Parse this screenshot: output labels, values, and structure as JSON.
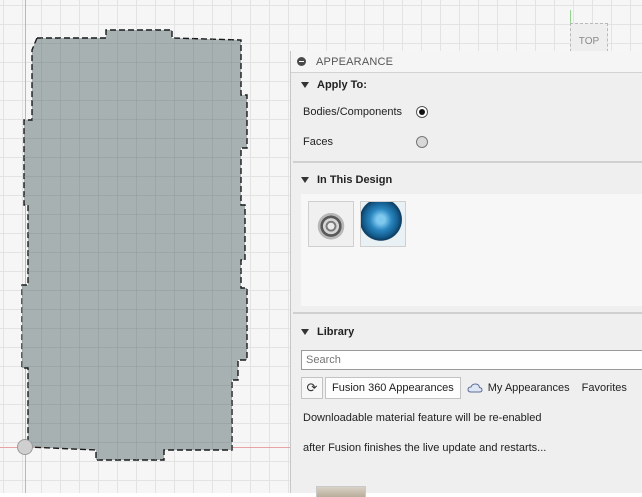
{
  "viewcube": {
    "face_label": "TOP"
  },
  "panel": {
    "title": "APPEARANCE",
    "apply_to": {
      "heading": "Apply To:",
      "options": [
        {
          "label": "Bodies/Components",
          "selected": true
        },
        {
          "label": "Faces",
          "selected": false
        }
      ]
    },
    "in_this_design": {
      "heading": "In This Design",
      "thumbnails": [
        "metal-material-thumbnail",
        "glass-material-thumbnail"
      ]
    },
    "library": {
      "heading": "Library",
      "search_placeholder": "Search",
      "tabs": {
        "fusion": "Fusion 360 Appearances",
        "mine": "My Appearances",
        "favorites": "Favorites"
      },
      "message_line1": "Downloadable material feature will be re-enabled",
      "message_line2": "after Fusion finishes the live update and restarts..."
    }
  },
  "colors": {
    "body_fill": "#a7b1b2",
    "body_outline": "#1a1a1a",
    "y_axis": "#8fd48f",
    "x_axis": "#e7a3a3"
  }
}
